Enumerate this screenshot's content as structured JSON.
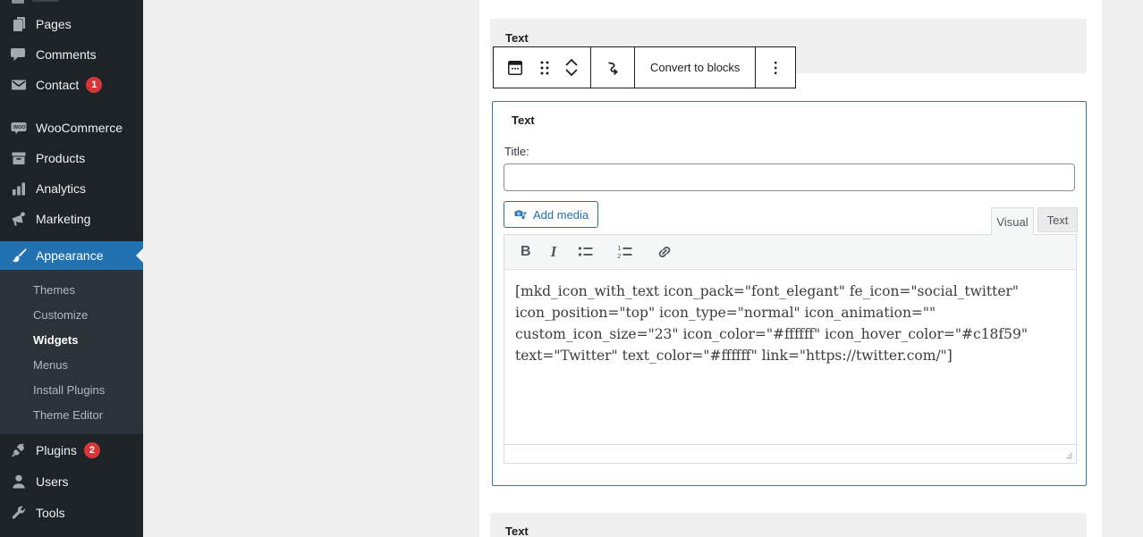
{
  "app": {
    "context": "WordPress admin widgets editor"
  },
  "colors": {
    "sidebar_bg": "#1d2327",
    "submenu_bg": "#2c3338",
    "active_menu_blue": "#2271b1",
    "badge_red": "#d63638",
    "content_bg": "#f0f0f1",
    "selected_block_border": "#2e77b3",
    "toolbar_border": "#1e1e1e"
  },
  "sidebar": {
    "items": [
      {
        "label": "Pages"
      },
      {
        "label": "Comments"
      },
      {
        "label": "Contact",
        "badge": "1"
      },
      {
        "label": "WooCommerce"
      },
      {
        "label": "Products"
      },
      {
        "label": "Analytics"
      },
      {
        "label": "Marketing"
      },
      {
        "label": "Appearance",
        "active": true
      },
      {
        "label": "Plugins",
        "badge": "2"
      },
      {
        "label": "Users"
      },
      {
        "label": "Tools"
      }
    ],
    "appearance_submenu": {
      "current": "Widgets",
      "items": [
        {
          "label": "Themes"
        },
        {
          "label": "Customize"
        },
        {
          "label": "Widgets"
        },
        {
          "label": "Menus"
        },
        {
          "label": "Install Plugins"
        },
        {
          "label": "Theme Editor"
        }
      ]
    }
  },
  "widget_area": {
    "top_block": {
      "title": "Text"
    },
    "toolbar": {
      "convert_label": "Convert to blocks"
    },
    "block": {
      "title": "Text",
      "title_field_label": "Title:",
      "title_field_value": "",
      "add_media_label": "Add media",
      "tabs": {
        "visual": "Visual",
        "text": "Text",
        "active": "Visual"
      },
      "editor_toolbar": {
        "bold": "B",
        "italic": "I"
      },
      "content": "[mkd_icon_with_text icon_pack=\"font_elegant\" fe_icon=\"social_twitter\" icon_position=\"top\" icon_type=\"normal\" icon_animation=\"\" custom_icon_size=\"23\" icon_color=\"#ffffff\" icon_hover_color=\"#c18f59\" text=\"Twitter\" text_color=\"#ffffff\" link=\"https://twitter.com/\"]"
    },
    "bottom_block": {
      "title": "Text"
    }
  },
  "icons": {
    "sidebar": [
      "pages-icon",
      "comments-icon",
      "contact-mail-icon",
      "woocommerce-icon",
      "products-box-icon",
      "analytics-bars-icon",
      "marketing-megaphone-icon",
      "appearance-brush-icon",
      "plugins-plug-icon",
      "users-person-icon",
      "tools-wrench-icon"
    ],
    "block_toolbar": [
      "widget-block-icon",
      "drag-handle-icon",
      "move-up-icon",
      "move-down-icon",
      "transform-arrow-icon",
      "kebab-menu-icon"
    ],
    "editor": [
      "bold-icon",
      "italic-icon",
      "bulleted-list-icon",
      "numbered-list-icon",
      "link-icon",
      "resize-grip-icon",
      "media-camera-note-icon"
    ]
  }
}
